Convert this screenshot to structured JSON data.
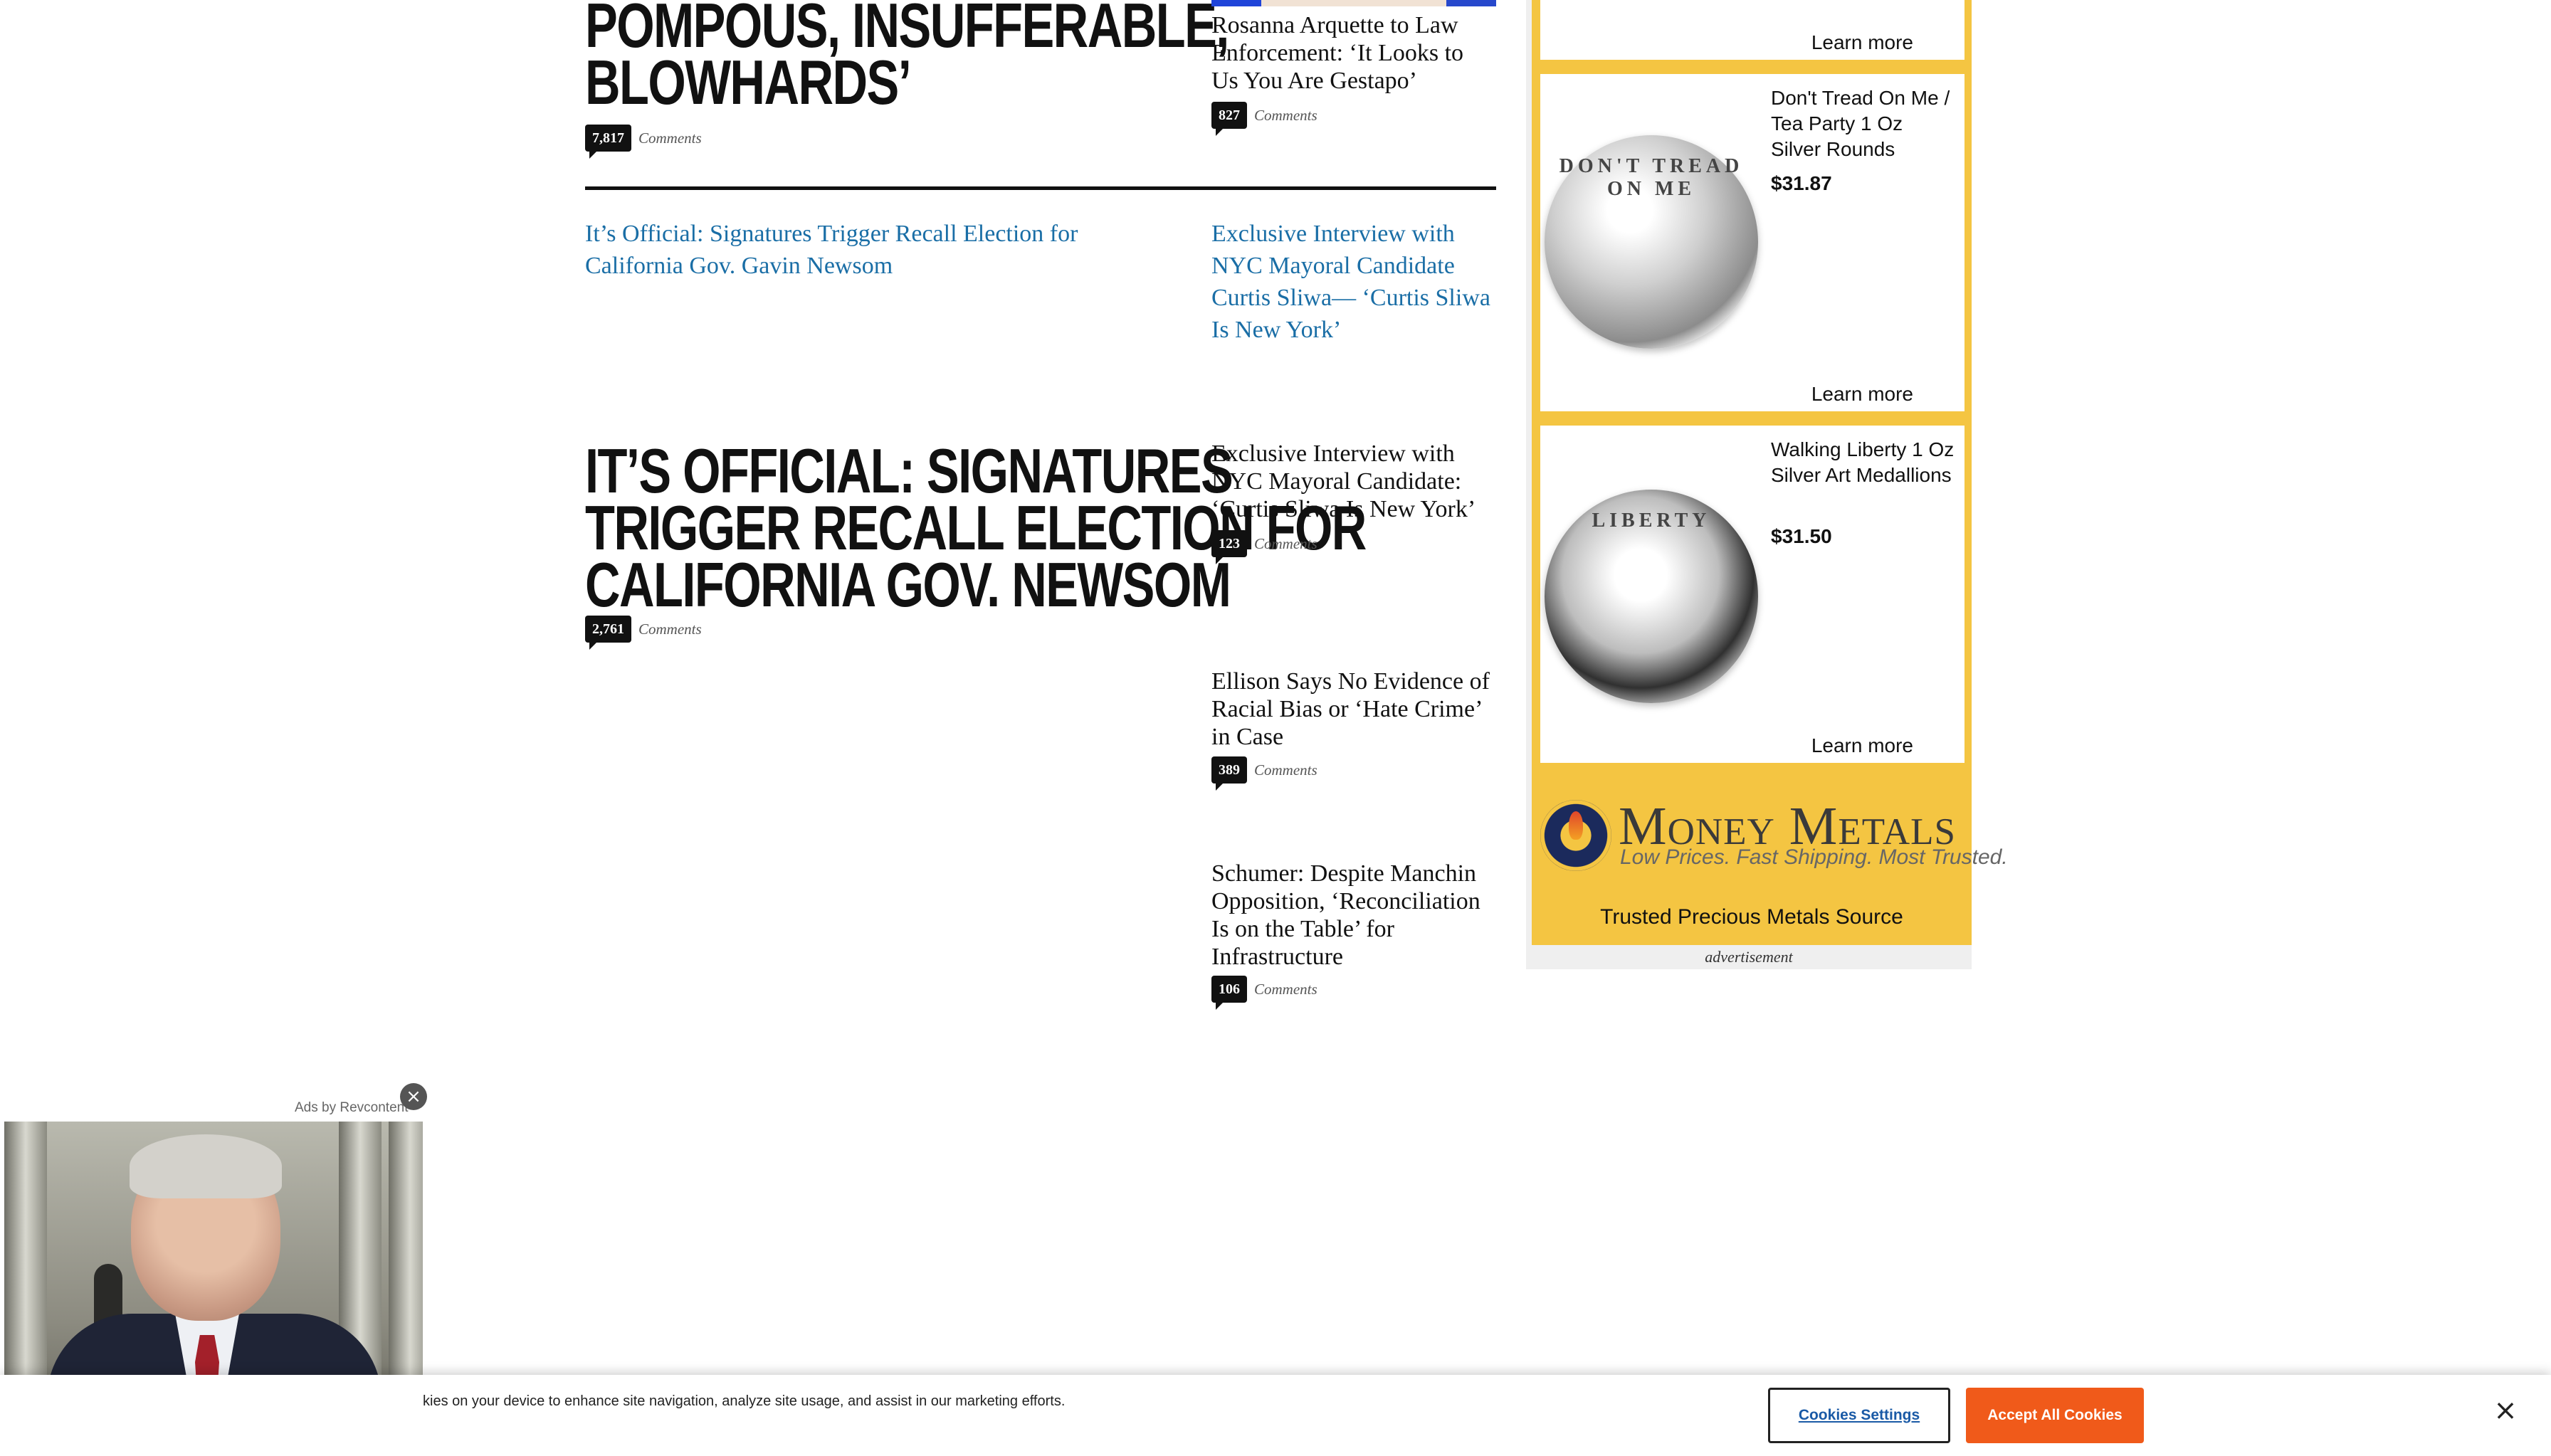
{
  "main": {
    "top_story": {
      "headline_line1": "POMPOUS, INSUFFERABLE,",
      "headline_line2": "BLOWHARDS’",
      "comment_count": "7,817",
      "comment_label": "Comments"
    },
    "side_top": {
      "title": "Rosanna Arquette to Law Enforcement: ‘It Looks to Us You Are Gestapo’",
      "comment_count": "827",
      "comment_label": "Comments"
    },
    "links": [
      "It’s Official: Signatures Trigger Recall Election for California Gov. Gavin Newsom",
      "Exclusive Interview with NYC Mayoral Candidate Curtis Sliwa— ‘Curtis Sliwa Is New York’"
    ],
    "feature": {
      "headline_line1": "IT’S OFFICIAL: SIGNATURES",
      "headline_line2": "TRIGGER RECALL ELECTION FOR",
      "headline_line3": "CALIFORNIA GOV. NEWSOM",
      "comment_count": "2,761",
      "comment_label": "Comments"
    },
    "side_stories": [
      {
        "title": "Exclusive Interview with NYC Mayoral Candidate: ‘Curtis Sliwa Is New York’",
        "comment_count": "123",
        "comment_label": "Comments"
      },
      {
        "title": "Ellison Says No Evidence of Racial Bias or ‘Hate Crime’ in Case",
        "comment_count": "389",
        "comment_label": "Comments"
      },
      {
        "title": "Schumer: Despite Manchin Opposition, ‘Reconciliation Is on the Table’ for Infrastructure",
        "comment_count": "106",
        "comment_label": "Comments"
      }
    ]
  },
  "ad": {
    "top_learn_more": "Learn more",
    "products": [
      {
        "name": "Don't Tread On Me / Tea Party 1 Oz Silver Rounds",
        "price": "$31.87",
        "learn_more": "Learn more",
        "coin_text": "DON'T TREAD ON ME",
        "icon": "silver-coin-snake-icon"
      },
      {
        "name": "Walking Liberty 1 Oz Silver Art Medallions",
        "price": "$31.50",
        "learn_more": "Learn more",
        "coin_text": "LIBERTY",
        "icon": "silver-coin-liberty-icon"
      }
    ],
    "brand_name": "Money Metals",
    "brand_tagline": "Low Prices. Fast Shipping. Most Trusted.",
    "brand_trusted": "Trusted Precious Metals Source",
    "advertisement_label": "advertisement",
    "colors": {
      "gold": "#f4c542",
      "navy": "#1b2a5c"
    }
  },
  "popup": {
    "label": "Ads by Revcontent",
    "close_icon": "close-icon"
  },
  "cookie": {
    "text": "kies on your device to enhance site navigation, analyze site usage, and assist in our marketing efforts.",
    "settings_label": "Cookies Settings",
    "accept_label": "Accept All Cookies",
    "close_glyph": "×",
    "colors": {
      "accept": "#f05a1a",
      "link": "#1a5aa6"
    }
  }
}
